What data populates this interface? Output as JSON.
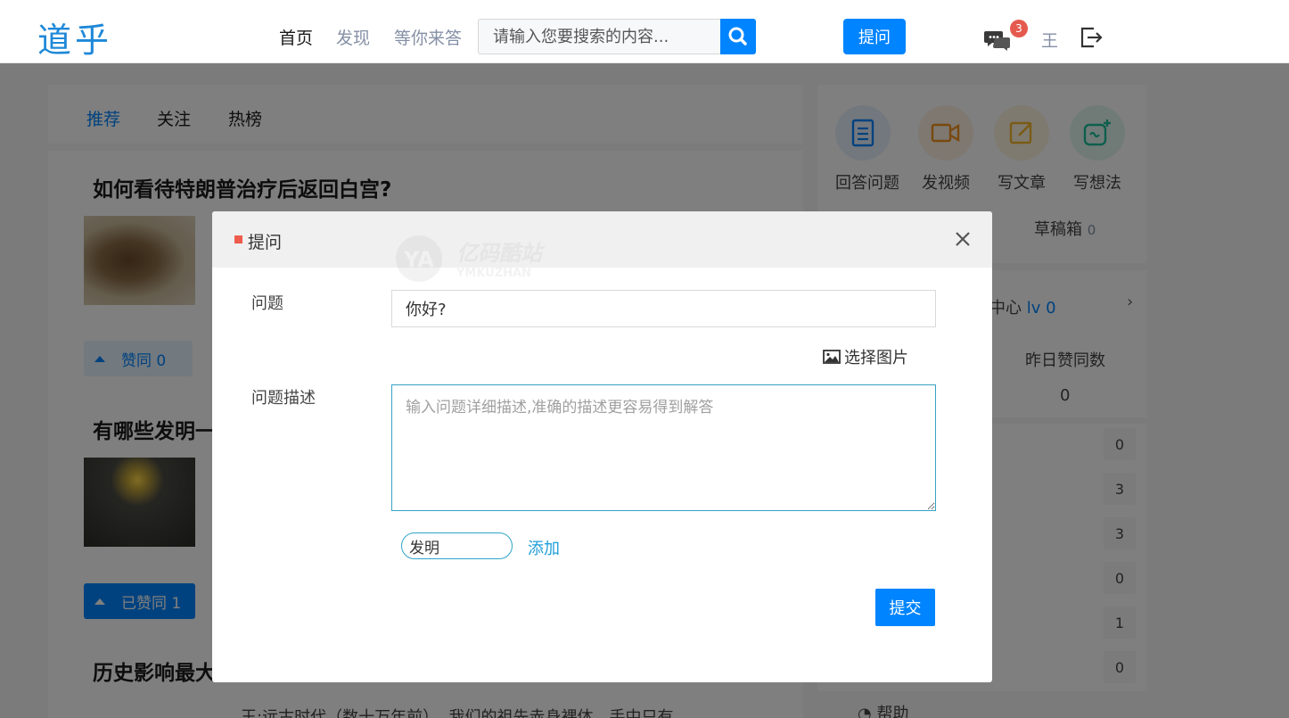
{
  "header": {
    "logo": "道乎",
    "nav": [
      "首页",
      "发现",
      "等你来答"
    ],
    "search_placeholder": "请输入您要搜索的内容...",
    "ask_label": "提问",
    "message_count": "3",
    "user_name": "王"
  },
  "main": {
    "tabs": [
      "推荐",
      "关注",
      "热榜"
    ],
    "questions": [
      {
        "title": "如何看待特朗普治疗后返回白宫?",
        "vote_label": "赞同 0"
      },
      {
        "title": "有哪些发明一",
        "vote_label": "已赞同 1"
      },
      {
        "title": "历史影响最大",
        "excerpt": "王:远古时代（数十万年前）, 我们的祖先赤身裸体，手中只有"
      }
    ]
  },
  "sidebar": {
    "actions": [
      "回答问题",
      "发视频",
      "写文章",
      "写想法"
    ],
    "drafts_label": "草稿箱",
    "drafts_count": "0",
    "center_label": "中心",
    "level": "lv 0",
    "yesterday_votes_label": "昨日赞同数",
    "yesterday_votes": "0",
    "counts": [
      "0",
      "3",
      "3",
      "0",
      "1",
      "0"
    ],
    "help_label": "帮助"
  },
  "modal": {
    "title": "提问",
    "question_label": "问题",
    "question_value": "你好?",
    "choose_image_label": "选择图片",
    "description_label": "问题描述",
    "description_placeholder": "输入问题详细描述,准确的描述更容易得到解答",
    "tag_value": "发明",
    "add_tag_label": "添加",
    "submit_label": "提交",
    "watermark_text": "亿码酷站",
    "watermark_sub": "YMKUZHAN"
  }
}
